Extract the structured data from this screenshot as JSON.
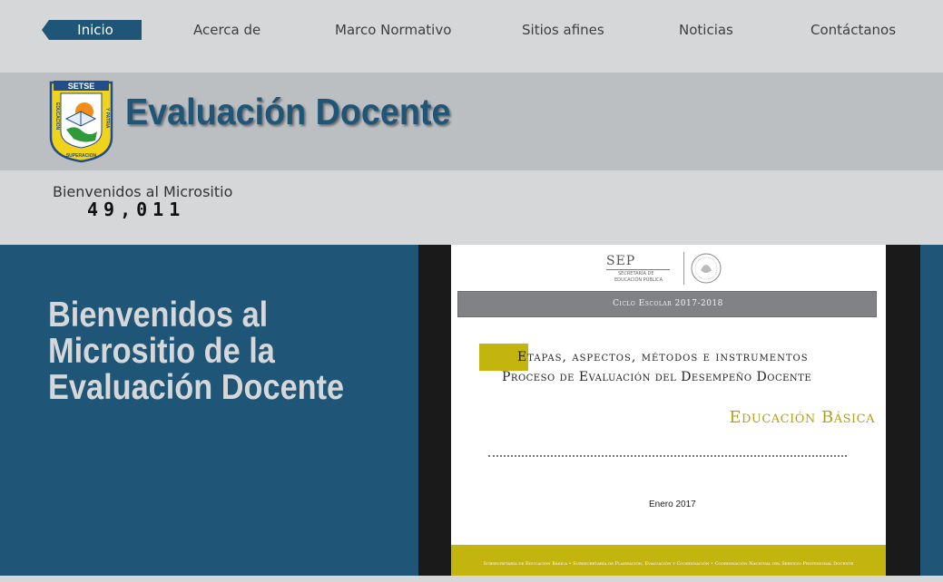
{
  "nav": {
    "items": [
      {
        "label": "Inicio",
        "active": true
      },
      {
        "label": "Acerca de"
      },
      {
        "label": "Marco Normativo"
      },
      {
        "label": "Sitios afines"
      },
      {
        "label": "Noticias"
      },
      {
        "label": "Contáctanos"
      }
    ]
  },
  "header": {
    "logo_text_top": "SETSE",
    "logo_text_left": "EDUCACION",
    "logo_text_right": "Y PATRIA",
    "logo_text_bottom": "SUPERACION",
    "title": "Evaluación Docente"
  },
  "counter": {
    "label": "Bienvenidos al Micrositio",
    "value": "49,011"
  },
  "main": {
    "heading_lines": [
      "Bienvenidos al",
      "Micrositio de la",
      "Evaluación Docente"
    ]
  },
  "document": {
    "sep_logo": "SEP",
    "sep_sub1": "SECRETARÍA DE",
    "sep_sub2": "EDUCACIÓN PÚBLICA",
    "cycle": "Ciclo Escolar 2017-2018",
    "title_line1": "Etapas, aspectos, métodos e instrumentos",
    "title_line2": "Proceso de Evaluación del Desempeño Docente",
    "level": "Educación Básica",
    "date": "Enero 2017",
    "footer": "Subsecretaría de Educación Básica • Subsecretaría de Planeación, Evaluación y Coordinación • Coordinación Nacional del Servicio Profesional Docente"
  },
  "colors": {
    "brand_blue": "#1f5577",
    "background": "#d5d7d8",
    "header_band": "#bcbfc2",
    "doc_gold": "#c4b40e"
  }
}
